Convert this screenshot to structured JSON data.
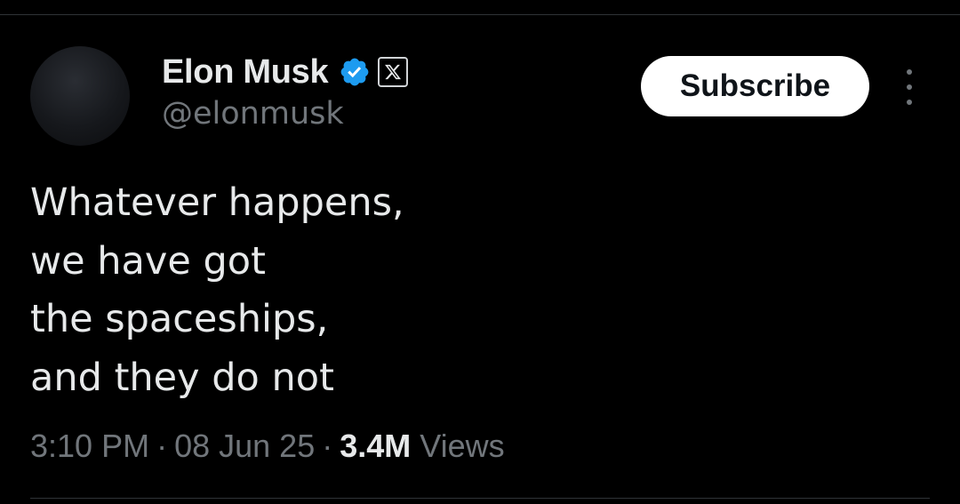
{
  "author": {
    "name": "Elon Musk",
    "handle": "@elonmusk",
    "verified_icon": "verified-badge-icon",
    "affiliation_icon": "x-logo-icon",
    "verified_color": "#1d9bf0"
  },
  "actions": {
    "subscribe_label": "Subscribe",
    "more_icon": "more-vertical-icon"
  },
  "tweet": {
    "lines": [
      "Whatever happens,",
      "we have got",
      "the spaceships,",
      "and they do not"
    ]
  },
  "meta": {
    "time": "3:10 PM",
    "separator": "·",
    "date": "08 Jun 25",
    "views_count": "3.4M",
    "views_label": "Views"
  },
  "colors": {
    "background": "#000000",
    "text_primary": "#e7e9ea",
    "text_secondary": "#71767b",
    "button_bg": "#ffffff",
    "button_text": "#0f1419"
  }
}
